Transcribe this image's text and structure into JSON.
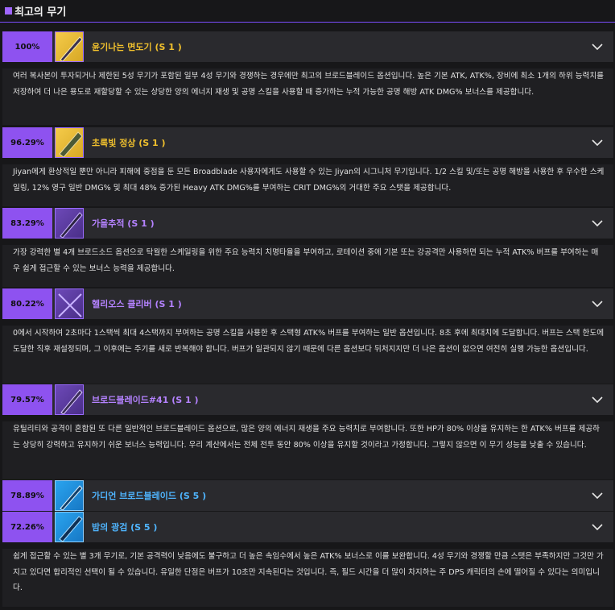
{
  "section": {
    "title": "최고의 무기"
  },
  "weapons": [
    {
      "percent": "100%",
      "name": "윤기나는 면도기 (S 1 )",
      "color": "gold",
      "description": "여러 복사본이 투자되거나 제한된 5성 무기가 포함된 일부 4성 무기와 경쟁하는 경우에만 최고의 브로드블레이드 옵션입니다. 높은 기본 ATK, ATK%, 장비에 최소 1개의 하위 능력치를 저장하여 더 나은 용도로 재할당할 수 있는 상당한 양의 에너지 재생 및 공명 스킬을 사용할 때 증가하는 누적 가능한 공명 해방 ATK DMG% 보너스를 제공합니다."
    },
    {
      "percent": "96.29%",
      "name": "초록빛 정상 (S 1 )",
      "color": "gold",
      "description": "Jiyan에게 환상적일 뿐만 아니라 피해에 중점을 둔 모든 Broadblade 사용자에게도 사용할 수 있는 Jiyan의 시그니처 무기입니다. 1/2 스킬 및/또는 공명 해방을 사용한 후 우수한 스케일링, 12% 영구 일반 DMG% 및 최대 48% 증가된 Heavy ATK DMG%를 부여하는 CRIT DMG%의 거대한 주요 스탯을 제공합니다."
    },
    {
      "percent": "83.29%",
      "name": "가을추적 (S 1 )",
      "color": "purple",
      "description": "가장 강력한 별 4개 브로드소드 옵션으로 탁월한 스케일링을 위한 주요 능력치 치명타율을 부여하고, 로테이션 중에 기본 또는 강공격만 사용하면 되는 누적 ATK% 버프를 부여하는 매우 쉽게 접근할 수 있는 보너스 능력을 제공합니다."
    },
    {
      "percent": "80.22%",
      "name": "헬리오스 클리버 (S 1 )",
      "color": "purple",
      "description": "0에서 시작하여 2초마다 1스택씩 최대 4스택까지 부여하는 공명 스킬을 사용한 후 스택형 ATK% 버프를 부여하는 일반 옵션입니다. 8초 후에 최대치에 도달합니다. 버프는 스택 한도에 도달한 직후 재설정되며, 그 이후에는 주기를 새로 반복해야 합니다. 버프가 일관되지 않기 때문에 다른 옵션보다 뒤처지지만 더 나은 옵션이 없으면 여전히 실행 가능한 옵션입니다."
    },
    {
      "percent": "79.57%",
      "name": "브로드블레이드#41 (S 1 )",
      "color": "purple",
      "description": "유틸리티와 공격이 혼합된 또 다른 일반적인 브로드블레이드 옵션으로, 많은 양의 에너지 재생을 주요 능력치로 부여합니다. 또한 HP가 80% 이상을 유지하는 한 ATK% 버프를 제공하는 상당히 강력하고 유지하기 쉬운 보너스 능력입니다. 우리 계산에서는 전체 전투 동안 80% 이상을 유지할 것이라고 가정합니다. 그렇지 않으면 이 무기 성능을 낮출 수 있습니다."
    },
    {
      "percent": "78.89%",
      "name": "가디언 브로드블레이드 (S 5 )",
      "color": "blue",
      "description": ""
    },
    {
      "percent": "72.26%",
      "name": "밤의 광검 (S 5 )",
      "color": "blue",
      "description": "쉽게 접근할 수 있는 별 3개 무기로, 기본 공격력이 낮음에도 불구하고 더 높은 속임수에서 높은 ATK% 보너스로 이를 보완합니다. 4성 무기와 경쟁할 만큼 스탯은 부족하지만 그것만 가지고 있다면 합리적인 선택이 될 수 있습니다. 유일한 단점은 버프가 10초만 지속된다는 것입니다. 즉, 필드 시간을 더 많이 차지하는 주 DPS 캐릭터의 손에 떨어질 수 있다는 의미입니다."
    }
  ],
  "colors": {
    "accent": "#8e52f0",
    "gold": "#f0c02d",
    "purple": "#b482ff",
    "blue": "#4fb5ff"
  }
}
